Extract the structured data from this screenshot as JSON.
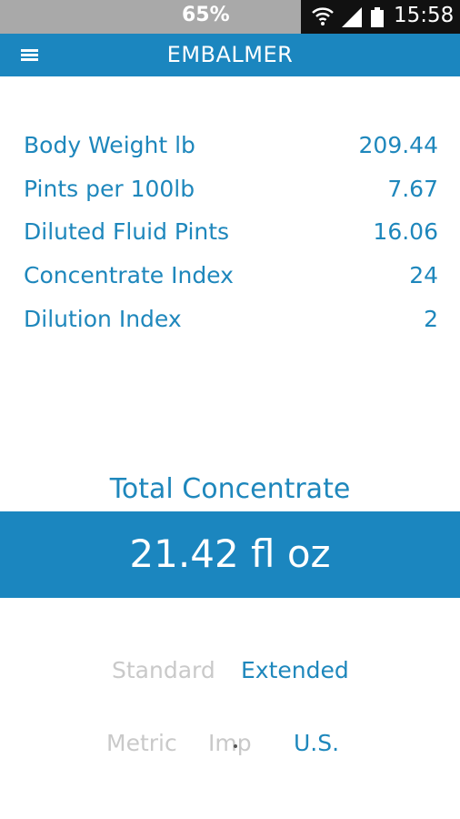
{
  "status_bar": {
    "battery_percent": "65%",
    "time": "15:58"
  },
  "app_bar": {
    "title": "EMBALMER"
  },
  "metrics": [
    {
      "label": "Body Weight lb",
      "value": "209.44"
    },
    {
      "label": "Pints per 100lb",
      "value": "7.67"
    },
    {
      "label": "Diluted Fluid Pints",
      "value": "16.06"
    },
    {
      "label": "Concentrate Index",
      "value": "24"
    },
    {
      "label": "Dilution Index",
      "value": "2"
    }
  ],
  "total": {
    "label": "Total Concentrate",
    "value": "21.42 fl oz"
  },
  "mode_toggle": {
    "options": [
      "Standard",
      "Extended"
    ],
    "selected": "Extended"
  },
  "unit_toggle": {
    "options": [
      "Metric",
      "Imp",
      "U.S."
    ],
    "selected": "U.S."
  },
  "colors": {
    "accent": "#1b86bf",
    "text_accent": "#1e87bc",
    "inactive": "#c9c9c9"
  }
}
